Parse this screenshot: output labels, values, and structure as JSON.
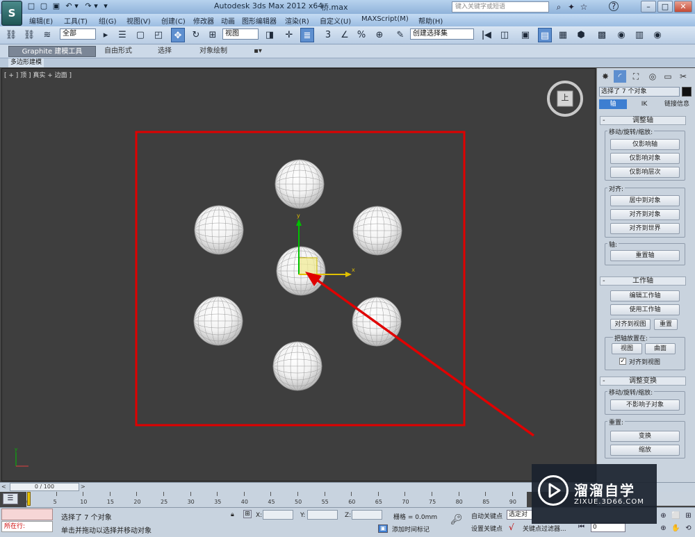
{
  "app": {
    "icon_label": "S",
    "title": "Autodesk 3ds Max  2012 x64",
    "file": "桥.max",
    "search_placeholder": "键入关键字或短语",
    "window_controls": [
      "–",
      "□",
      "✕"
    ]
  },
  "quick_access": [
    "□",
    "▢",
    "▣",
    "↶",
    "▾",
    "↷",
    "▾",
    "▾"
  ],
  "title_tools": [
    "⌕",
    "✦",
    "☆",
    "?"
  ],
  "menu": [
    "编辑(E)",
    "工具(T)",
    "组(G)",
    "视图(V)",
    "创建(C)",
    "修改器",
    "动画",
    "图形编辑器",
    "渲染(R)",
    "自定义(U)",
    "MAXScript(M)",
    "帮助(H)"
  ],
  "toolbar": {
    "selection_filter": "全部",
    "ref_coord": "视图",
    "named_selection": "创建选择集",
    "tools": [
      "⛓",
      "⛓",
      "≋",
      "▸",
      "☰",
      "▢",
      "◰",
      "✥",
      "↻",
      "⊞",
      "✛",
      "◨",
      "3",
      "∠",
      "%",
      "⊕",
      "✎",
      "ǀ◀",
      "◫",
      "≣",
      "▣",
      "▤",
      "▦",
      "⬢",
      "▩",
      "◉",
      "▥"
    ]
  },
  "ribbon": {
    "tabs": [
      "Graphite 建模工具",
      "自由形式",
      "选择",
      "对象绘制"
    ],
    "sub_label": "多边形建模"
  },
  "viewport": {
    "label": "[ + ] 顶 ] 真实 + 边面 ]",
    "axis_x": "x",
    "axis_y": "y",
    "viewcube": "上"
  },
  "command_panel": {
    "tabs": [
      "✸",
      "◜",
      "⛶",
      "◎",
      "▭",
      "✂"
    ],
    "selection": "选择了 7 个对象",
    "subtabs": [
      "轴",
      "IK",
      "链接信息"
    ],
    "adjust_pivot": {
      "title": "调整轴",
      "move_group": "移动/旋转/缩放:",
      "buttons": [
        "仅影响轴",
        "仅影响对象",
        "仅影响层次"
      ],
      "align_group": "对齐:",
      "align_buttons": [
        "居中到对象",
        "对齐到对象",
        "对齐到世界"
      ],
      "pivot_group": "轴:",
      "reset_pivot": "重置轴"
    },
    "working_pivot": {
      "title": "工作轴",
      "edit": "编辑工作轴",
      "use": "使用工作轴",
      "align_view": "对齐到视图",
      "reset": "重置",
      "place_group": "把轴放置在:",
      "view": "视图",
      "surface": "曲面",
      "align_checkbox": "对齐到视图"
    },
    "adjust_transform": {
      "title": "调整变换",
      "move_group": "移动/旋转/缩放:",
      "dont_affect": "不影响子对象",
      "reset_group": "重置:",
      "transform": "变换",
      "scale": "缩放"
    }
  },
  "timeline": {
    "slider": "0 / 100",
    "ticks": [
      "0",
      "5",
      "10",
      "15",
      "20",
      "25",
      "30",
      "35",
      "40",
      "45",
      "50",
      "55",
      "60",
      "65",
      "70",
      "75",
      "80",
      "85",
      "90"
    ]
  },
  "status": {
    "running_label": "所在行:",
    "selected": "选择了 7 个对象",
    "prompt": "单击并拖动以选择并移动对象",
    "x_label": "X:",
    "y_label": "Y:",
    "z_label": "Z:",
    "grid": "栅格 = 0.0mm",
    "add_time_tag": "添加时间标记",
    "auto_key": "自动关键点",
    "auto_key_value": "选定对象",
    "set_key": "设置关键点",
    "key_filters": "关键点过滤器...",
    "frame": "0",
    "nav_icons": [
      "⏮",
      "⊕",
      "⊞",
      "✋",
      "⟲",
      "⬜"
    ]
  },
  "watermark": {
    "name": "溜溜自学",
    "url": "ZIXUE.3D66.COM"
  },
  "colors": {
    "annotation_red": "#e00000",
    "active_blue": "#3d7ed1",
    "viewport_bg": "#3e3e3e"
  }
}
